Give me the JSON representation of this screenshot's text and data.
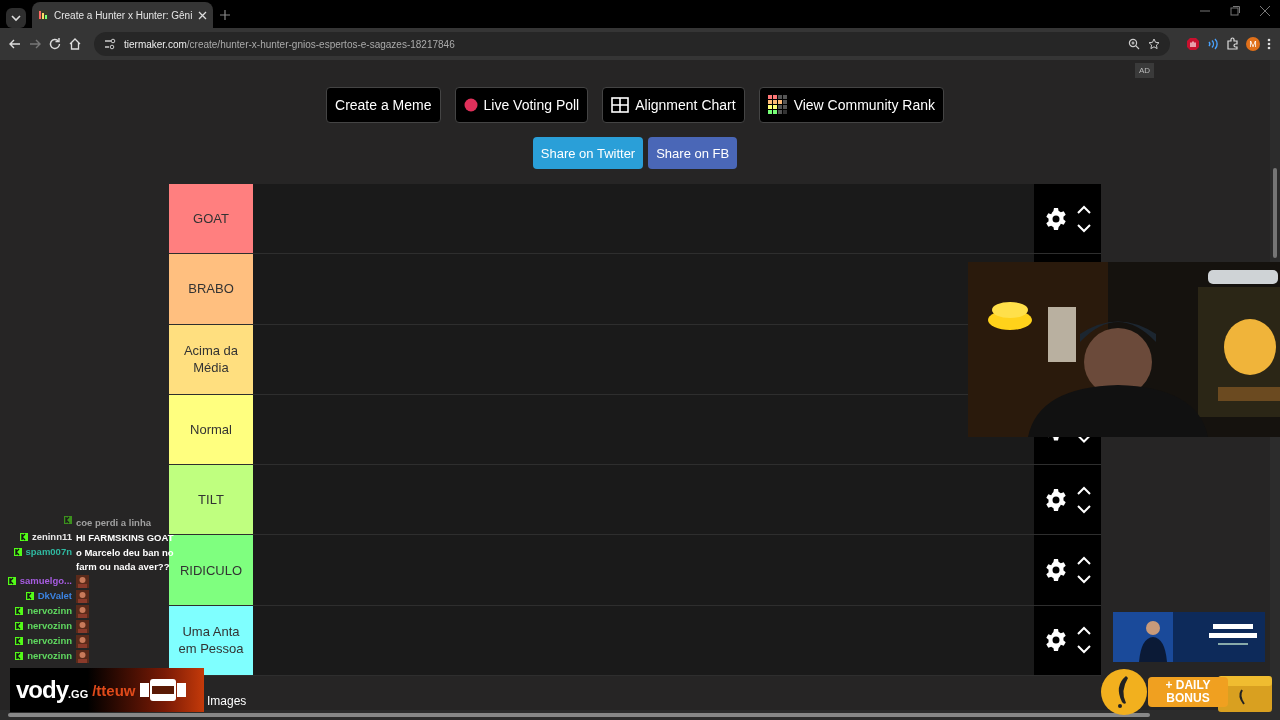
{
  "browser": {
    "tab_title": "Create a Hunter x Hunter: Gêni",
    "url_domain": "tiermaker.com",
    "url_path": "/create/hunter-x-hunter-gnios-espertos-e-sagazes-18217846",
    "profile_initial": "M"
  },
  "ad_tag": "AD",
  "actions": [
    {
      "label": "Create a Meme",
      "kind": "plain"
    },
    {
      "label": "Live Voting Poll",
      "kind": "dot"
    },
    {
      "label": "Alignment Chart",
      "kind": "grid"
    },
    {
      "label": "View Community Rank",
      "kind": "rank"
    }
  ],
  "share": [
    {
      "label": "Share on Twitter",
      "color": "#2a9fd8"
    },
    {
      "label": "Share on FB",
      "color": "#4a67b7"
    }
  ],
  "tiers": [
    {
      "label": "GOAT",
      "color": "#ff7f7f"
    },
    {
      "label": "BRABO",
      "color": "#ffbf7f"
    },
    {
      "label": "Acima da Média",
      "color": "#ffdf7f"
    },
    {
      "label": "Normal",
      "color": "#ffff7f"
    },
    {
      "label": "TILT",
      "color": "#bfff7f"
    },
    {
      "label": "RIDICULO",
      "color": "#7fff7f"
    },
    {
      "label": "Uma Anta em Pessoa",
      "color": "#7fffff"
    }
  ],
  "images_heading": "Images",
  "chat": [
    {
      "text": "coe perdi a linha",
      "kind": "dim"
    },
    {
      "user": "zeninn11",
      "text": "HI FARMSKINS GOAT",
      "kind": "text",
      "color": "#e8e8e8"
    },
    {
      "user": "spam007n",
      "text": "o Marcelo deu ban no farm ou nada aver??",
      "kind": "text",
      "color": "#2fb8a0"
    },
    {
      "user": "samuelgo...",
      "kind": "emote",
      "color": "#a65ce0"
    },
    {
      "user": "DkValet",
      "kind": "emote",
      "color": "#3b82e0"
    },
    {
      "user": "nervozinn",
      "kind": "emote",
      "color": "#5fd85f"
    },
    {
      "user": "nervozinn",
      "kind": "emote",
      "color": "#5fd85f"
    },
    {
      "user": "nervozinn",
      "kind": "emote",
      "color": "#5fd85f"
    },
    {
      "user": "nervozinn",
      "kind": "emote",
      "color": "#5fd85f"
    }
  ],
  "stream_logo": {
    "brand": "vody",
    "domain": ".GG",
    "handle": "/tteuw"
  },
  "bonus": {
    "line1": "+ DAILY",
    "line2": "BONUS"
  }
}
